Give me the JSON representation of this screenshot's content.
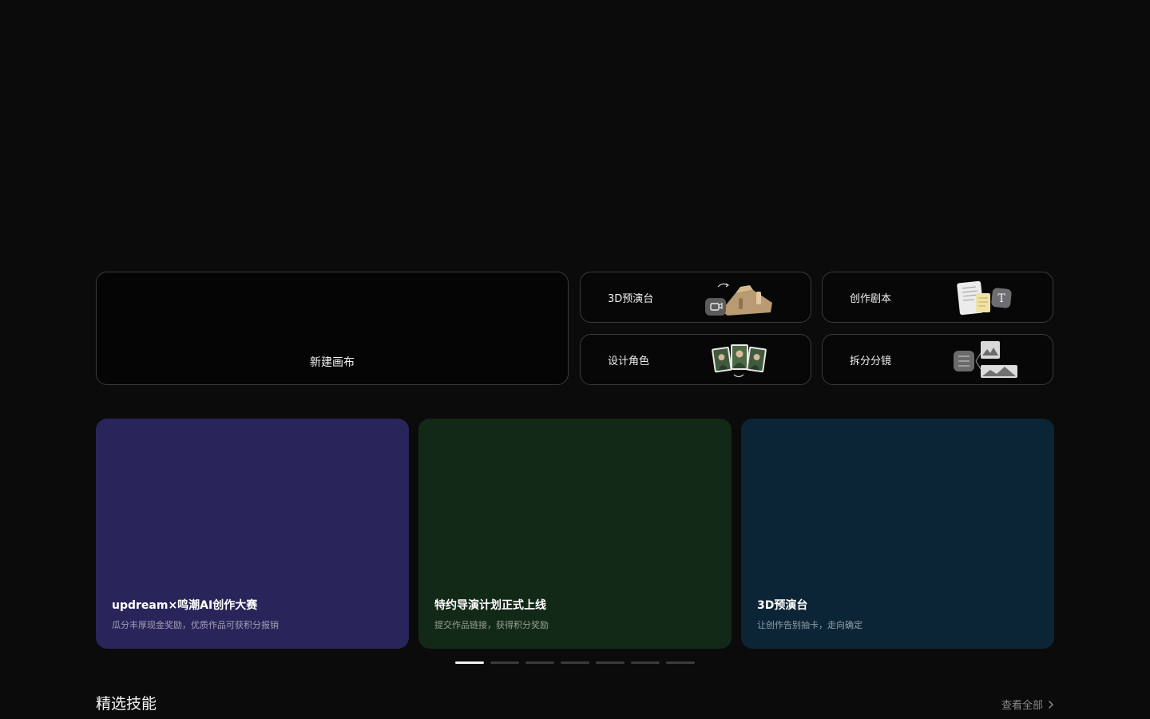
{
  "quick_actions": {
    "new_canvas_label": "新建画布",
    "tools": [
      {
        "label": "3D预演台",
        "icon": "3d-stage-thumbnail-icon"
      },
      {
        "label": "创作剧本",
        "icon": "script-documents-icon"
      },
      {
        "label": "设计角色",
        "icon": "character-portraits-icon"
      },
      {
        "label": "拆分分镜",
        "icon": "storyboard-split-icon"
      }
    ]
  },
  "banners": [
    {
      "title": "updream×鸣潮AI创作大赛",
      "subtitle": "瓜分丰厚现金奖励，优质作品可获积分报销",
      "color": "#29255a"
    },
    {
      "title": "特约导演计划正式上线",
      "subtitle": "提交作品链接，获得积分奖励",
      "color": "#132917"
    },
    {
      "title": "3D预演台",
      "subtitle": "让创作告别抽卡，走向确定",
      "color": "#0c2536"
    }
  ],
  "pager": {
    "count": 7,
    "active_index": 0
  },
  "section": {
    "title": "精选技能",
    "view_all_label": "查看全部"
  },
  "colors": {
    "background": "#0b0b0b",
    "card_border": "#3a3a3a",
    "pager_active": "#f2f2f2",
    "pager_inactive": "#3b3b3b"
  }
}
